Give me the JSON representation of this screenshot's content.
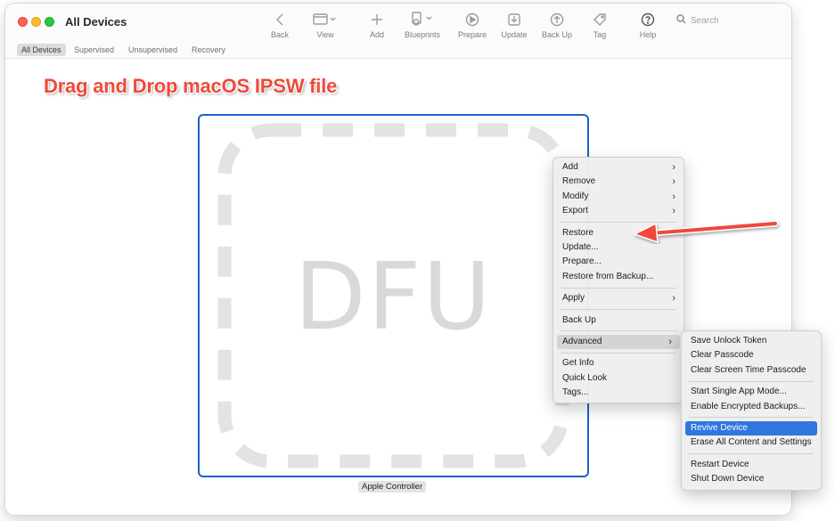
{
  "window": {
    "title": "All Devices"
  },
  "toolbar": {
    "back": "Back",
    "view": "View",
    "add": "Add",
    "blueprints": "Blueprints",
    "prepare": "Prepare",
    "update": "Update",
    "backup": "Back Up",
    "tag": "Tag",
    "help": "Help"
  },
  "search": {
    "placeholder": "Search",
    "value": ""
  },
  "filters": {
    "all": "All Devices",
    "supervised": "Supervised",
    "unsupervised": "Unsupervised",
    "recovery": "Recovery"
  },
  "annotation": {
    "headline": "Drag and Drop macOS IPSW file"
  },
  "device": {
    "label": "DFU",
    "name": "Apple Controller"
  },
  "context_menu": {
    "items": [
      {
        "label": "Add",
        "submenu": true
      },
      {
        "label": "Remove",
        "submenu": true
      },
      {
        "label": "Modify",
        "submenu": true
      },
      {
        "label": "Export",
        "submenu": true
      },
      {
        "label": "Restore",
        "submenu": false
      },
      {
        "label": "Update...",
        "submenu": false
      },
      {
        "label": "Prepare...",
        "submenu": false
      },
      {
        "label": "Restore from Backup...",
        "submenu": false
      },
      {
        "label": "Apply",
        "submenu": true
      },
      {
        "label": "Back Up",
        "submenu": false
      },
      {
        "label": "Advanced",
        "submenu": true
      },
      {
        "label": "Get Info",
        "submenu": false
      },
      {
        "label": "Quick Look",
        "submenu": false
      },
      {
        "label": "Tags...",
        "submenu": false
      }
    ],
    "chevron": "›"
  },
  "advanced_submenu": {
    "items": [
      {
        "label": "Save Unlock Token"
      },
      {
        "label": "Clear Passcode"
      },
      {
        "label": "Clear Screen Time Passcode"
      },
      {
        "label": "Start Single App Mode..."
      },
      {
        "label": "Enable Encrypted Backups..."
      },
      {
        "label": "Revive Device"
      },
      {
        "label": "Erase All Content and Settings"
      },
      {
        "label": "Restart Device"
      },
      {
        "label": "Shut Down Device"
      }
    ],
    "selected": "Revive Device"
  },
  "colors": {
    "accent": "#2f76e0",
    "annotation": "#ee4a3b",
    "tile_border": "#1a63cc"
  }
}
